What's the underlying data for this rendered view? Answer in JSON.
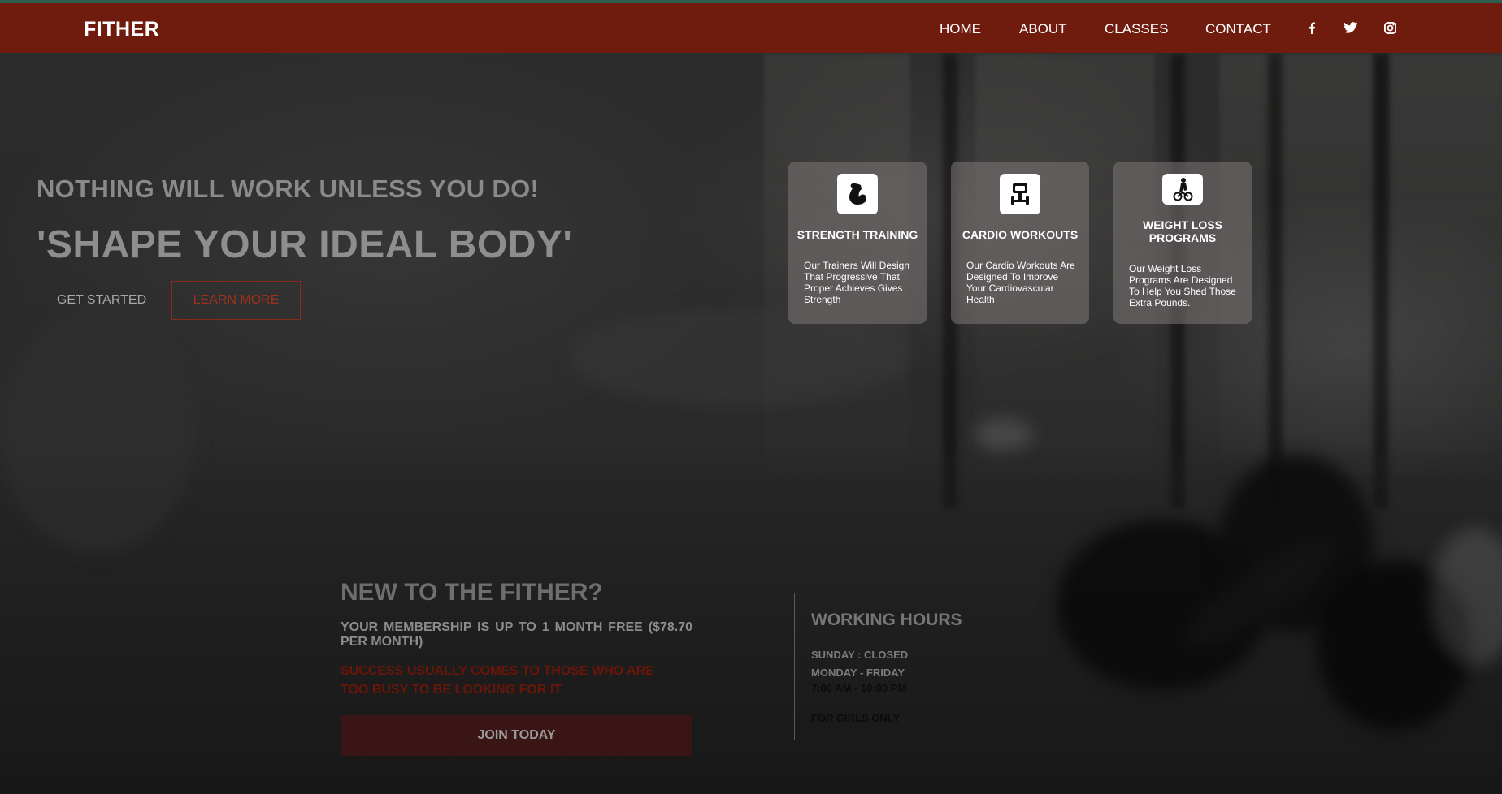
{
  "nav": {
    "brand": "FITHER",
    "links": [
      "HOME",
      "ABOUT",
      "CLASSES",
      "CONTACT"
    ],
    "social_icons": [
      "facebook-icon",
      "twitter-icon",
      "instagram-icon"
    ]
  },
  "hero": {
    "subtitle": "NOTHING WILL WORK UNLESS YOU DO!",
    "title": "'SHAPE YOUR IDEAL BODY'",
    "get_started": "GET STARTED",
    "learn_more": "LEARN MORE"
  },
  "features": [
    {
      "icon": "flexed-arm-icon",
      "title": "STRENGTH TRAINING",
      "text": "Our Trainers Will Design That Progressive That Proper Achieves Gives Strength"
    },
    {
      "icon": "dumbbell-machine-icon",
      "title": "CARDIO WORKOUTS",
      "text": "Our Cardio Workouts Are Designed To Improve Your Cardiovascular Health"
    },
    {
      "icon": "exercise-bike-icon",
      "title": "WEIGHT LOSS PROGRAMS",
      "text": "Our Weight Loss Programs Are Designed To Help You Shed Those Extra Pounds."
    }
  ],
  "membership": {
    "title": "NEW TO THE FITHER?",
    "offer": "YOUR MEMBERSHIP IS UP TO 1 MONTH FREE ($78.70 PER MONTH)",
    "quote": "SUCCESS USUALLY COMES TO THOSE WHO ARE TOO BUSY TO BE LOOKING FOR IT",
    "join": "JOIN TODAY"
  },
  "hours": {
    "title": "WORKING HOURS",
    "sunday": "SUNDAY : CLOSED",
    "weekdays": "MONDAY - FRIDAY",
    "weekday_time": "7:00 AM - 10:00 PM",
    "note": "FOR GIRLS ONLY"
  },
  "colors": {
    "navbar": "#6f1b0d",
    "accent_red": "#8a2a18",
    "join_button": "#3a1515",
    "top_line": "#2f5f4f"
  }
}
